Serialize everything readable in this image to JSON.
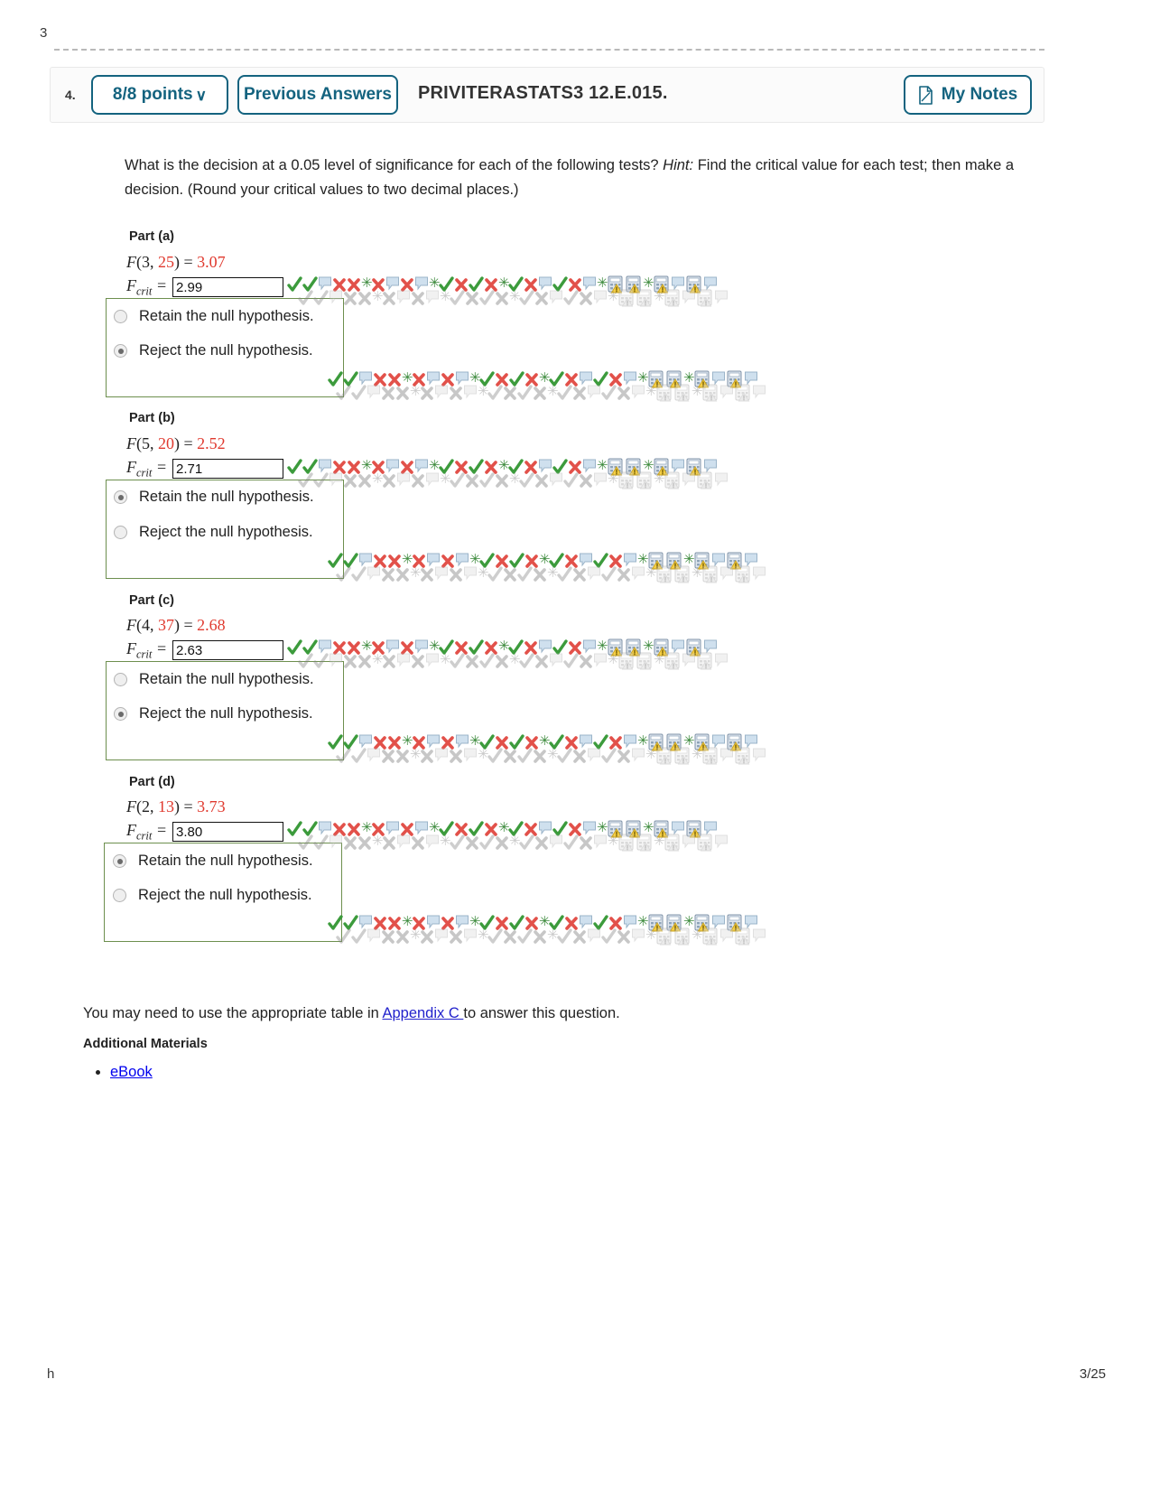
{
  "page": {
    "top_marker": "3",
    "footer_left": "h",
    "footer_right": "3/25"
  },
  "header": {
    "question_number": "4.",
    "points_label": "8/8 points",
    "points_chevron": "chevron-down-icon",
    "previous_answers_label": "Previous Answers",
    "question_title": "PRIVITERASTATS3 12.E.015.",
    "my_notes_label": "My Notes",
    "my_notes_icon": "note-page-icon",
    "accent_color": "#14637f"
  },
  "prompt": {
    "text_before_hint": "What is the decision at a 0.05 level of significance for each of the following tests? ",
    "hint_label": "Hint:",
    "text_after_hint": " Find the critical value for each test; then make a decision. (Round your critical values to two decimal places.)"
  },
  "parts": [
    {
      "label": "Part (a)",
      "f_prefix": "F",
      "df1": "3",
      "df2": "25",
      "f_value": "3.07",
      "fcrit_label": "F",
      "fcrit_sub": "crit",
      "fcrit_value": "2.99",
      "options": [
        {
          "label": "Retain the null hypothesis.",
          "selected": false
        },
        {
          "label": "Reject the null hypothesis.",
          "selected": true
        }
      ]
    },
    {
      "label": "Part (b)",
      "f_prefix": "F",
      "df1": "5",
      "df2": "20",
      "f_value": "2.52",
      "fcrit_label": "F",
      "fcrit_sub": "crit",
      "fcrit_value": "2.71",
      "options": [
        {
          "label": "Retain the null hypothesis.",
          "selected": true
        },
        {
          "label": "Reject the null hypothesis.",
          "selected": false
        }
      ]
    },
    {
      "label": "Part (c)",
      "f_prefix": "F",
      "df1": "4",
      "df2": "37",
      "f_value": "2.68",
      "fcrit_label": "F",
      "fcrit_sub": "crit",
      "fcrit_value": "2.63",
      "options": [
        {
          "label": "Retain the null hypothesis.",
          "selected": false
        },
        {
          "label": "Reject the null hypothesis.",
          "selected": true
        }
      ]
    },
    {
      "label": "Part (d)",
      "f_prefix": "F",
      "df1": "2",
      "df2": "13",
      "f_value": "3.73",
      "fcrit_label": "F",
      "fcrit_sub": "crit",
      "fcrit_value": "3.80",
      "options": [
        {
          "label": "Retain the null hypothesis.",
          "selected": true
        },
        {
          "label": "Reject the null hypothesis.",
          "selected": false
        }
      ]
    }
  ],
  "footer_content": {
    "appendix_text_before": "You may need to use the appropriate table in ",
    "appendix_link": "Appendix C ",
    "appendix_text_after": "to answer this question.",
    "additional_materials_heading": "Additional Materials",
    "ebook_label": "eBook"
  },
  "decor": {
    "glyph_sequence": [
      "check-icon",
      "check-icon",
      "speech-bubble-icon",
      "cross-icon",
      "cross-icon",
      "star-icon",
      "cross-icon",
      "speech-bubble-icon",
      "cross-icon",
      "speech-bubble-icon",
      "star-icon",
      "check-icon",
      "cross-icon",
      "check-icon",
      "cross-icon",
      "star-icon",
      "check-icon",
      "cross-icon",
      "speech-bubble-icon",
      "check-icon",
      "cross-icon",
      "speech-bubble-icon",
      "star-icon",
      "calculator-icon",
      "calculator-icon",
      "star-icon",
      "calculator-icon",
      "speech-bubble-icon",
      "calculator-icon",
      "speech-bubble-icon"
    ],
    "colors": {
      "check": "#3c9b3c",
      "cross": "#e2514a",
      "star": "#3c8a3c",
      "bubble": "#cfe0ee"
    }
  }
}
